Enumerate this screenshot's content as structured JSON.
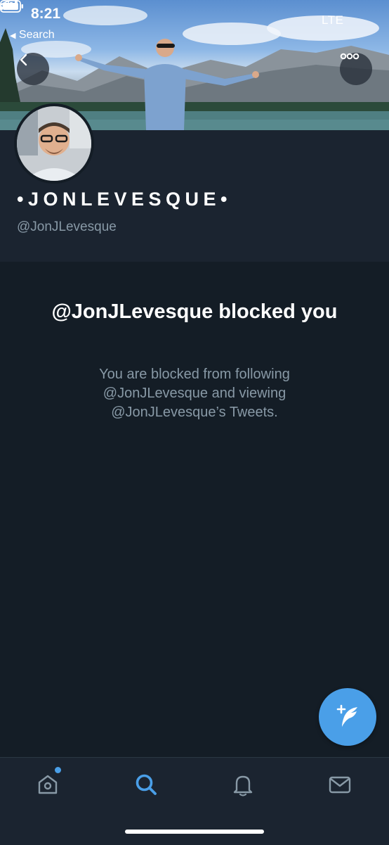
{
  "status_bar": {
    "time": "8:21",
    "back_app": "Search",
    "network": "LTE"
  },
  "profile": {
    "display_name": "•JONLEVESQUE•",
    "handle": "@JonJLevesque"
  },
  "blocked": {
    "title": "@JonJLevesque blocked you",
    "description": "You are blocked from following @JonJLevesque and viewing @JonJLevesque’s Tweets."
  },
  "tabbar": {
    "items": [
      {
        "icon": "home-icon",
        "active": false,
        "has_notification_dot": true
      },
      {
        "icon": "search-icon",
        "active": true
      },
      {
        "icon": "bell-icon",
        "active": false
      },
      {
        "icon": "mail-icon",
        "active": false
      }
    ]
  },
  "colors": {
    "background": "#141d26",
    "panel": "#1b2430",
    "accent": "#4a9fe8",
    "secondary_text": "#8899a6"
  }
}
